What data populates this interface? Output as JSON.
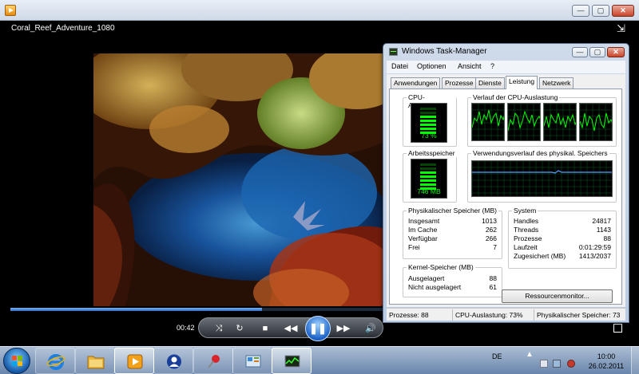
{
  "player": {
    "video_title": "Coral_Reef_Adventure_1080",
    "time_elapsed": "00:42",
    "progress": 0.67
  },
  "taskmanager": {
    "title": "Windows Task-Manager",
    "menu": [
      "Datei",
      "Optionen",
      "Ansicht",
      "?"
    ],
    "tabs": [
      "Anwendungen",
      "Prozesse",
      "Dienste",
      "Leistung",
      "Netzwerk"
    ],
    "active_tab": "Leistung",
    "cpu_usage_title": "CPU-Auslastung",
    "cpu_usage_value": "73 %",
    "cpu_history_title": "Verlauf der CPU-Auslastung",
    "memory_title": "Arbeitsspeicher",
    "memory_value": "746 MB",
    "memory_history_title": "Verwendungsverlauf des physikal. Speichers",
    "physical_memory": {
      "title": "Physikalischer Speicher (MB)",
      "rows": [
        {
          "label": "Insgesamt",
          "value": "1013"
        },
        {
          "label": "Im Cache",
          "value": "262"
        },
        {
          "label": "Verfügbar",
          "value": "266"
        },
        {
          "label": "Frei",
          "value": "7"
        }
      ]
    },
    "kernel_memory": {
      "title": "Kernel-Speicher (MB)",
      "rows": [
        {
          "label": "Ausgelagert",
          "value": "88"
        },
        {
          "label": "Nicht ausgelagert",
          "value": "61"
        }
      ]
    },
    "system": {
      "title": "System",
      "rows": [
        {
          "label": "Handles",
          "value": "24817"
        },
        {
          "label": "Threads",
          "value": "1143"
        },
        {
          "label": "Prozesse",
          "value": "88"
        },
        {
          "label": "Laufzeit",
          "value": "0:01:29:59"
        },
        {
          "label": "Zugesichert (MB)",
          "value": "1413/2037"
        }
      ]
    },
    "resource_monitor_button": "Ressourcenmonitor...",
    "status": {
      "processes": "Prozesse: 88",
      "cpu": "CPU-Auslastung: 73%",
      "memory": "Physikalischer Speicher: 73"
    }
  },
  "taskbar": {
    "language": "DE",
    "time": "10:00",
    "date": "26.02.2011",
    "buttons": [
      "internet-explorer",
      "windows-explorer",
      "media-player",
      "messenger",
      "pin-app",
      "control-panel",
      "task-manager"
    ]
  },
  "colors": {
    "graph_green": "#00ff00",
    "taskbar": "#8aa6c8",
    "title_blue": "#1e64c8"
  }
}
